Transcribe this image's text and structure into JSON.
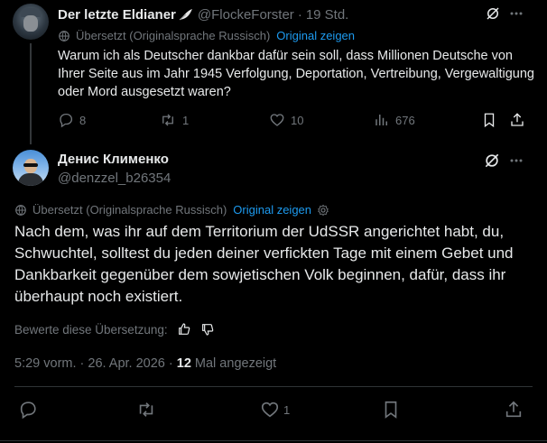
{
  "parent_tweet": {
    "author_name": "Der letzte Eldianer",
    "author_handle": "@FlockeForster",
    "separator": "·",
    "time": "19 Std.",
    "translation_label": "Übersetzt (Originalsprache Russisch)",
    "translation_link": "Original zeigen",
    "text": "Warum ich als Deutscher dankbar dafür sein soll, dass Millionen Deutsche von Ihrer Seite aus im Jahr 1945 Verfolgung, Deportation, Vertreibung, Vergewaltigung oder Mord ausgesetzt waren?",
    "replies": "8",
    "reposts": "1",
    "likes": "10",
    "views": "676"
  },
  "focal_tweet": {
    "author_name": "Денис Клименко",
    "author_handle": "@denzzel_b26354",
    "translation_label": "Übersetzt (Originalsprache Russisch)",
    "translation_link": "Original zeigen",
    "text": "Nach dem, was ihr auf dem Territorium der UdSSR angerichtet habt, du, Schwuchtel, solltest du jeden deiner verfickten Tage mit einem Gebet und Dankbarkeit gegenüber dem sowjetischen Volk beginnen, dafür, dass ihr überhaupt noch existiert.",
    "rate_label": "Bewerte diese Übersetzung:",
    "timestamp": "5:29 vorm. · 26. Apr. 2026 · ",
    "view_count": "12",
    "views_suffix": " Mal angezeigt",
    "likes": "1"
  },
  "colors": {
    "background": "#000000",
    "text": "#e7e9ea",
    "muted": "#71767b",
    "link": "#1d9bf0",
    "divider": "#2f3336"
  },
  "icons": [
    "globe-icon",
    "grok-icon",
    "more-icon",
    "reply-icon",
    "repost-icon",
    "like-icon",
    "views-icon",
    "bookmark-icon",
    "share-icon",
    "settings-icon",
    "thumbs-up-icon",
    "thumbs-down-icon",
    "feather-icon"
  ]
}
